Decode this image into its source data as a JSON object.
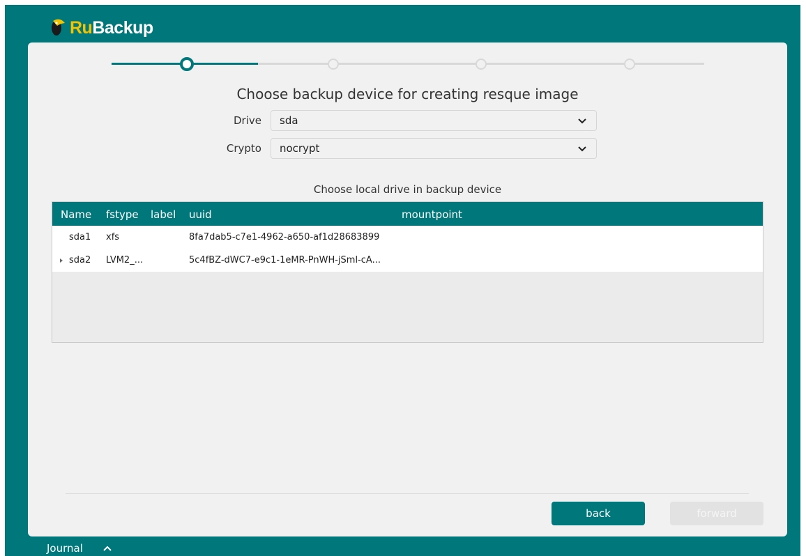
{
  "app": {
    "logo_prefix": "Ru",
    "logo_suffix": "Backup"
  },
  "wizard": {
    "title": "Choose backup device for creating resque image",
    "drive_label": "Drive",
    "drive_value": "sda",
    "crypto_label": "Crypto",
    "crypto_value": "nocrypt",
    "table_title": "Choose local drive in backup device"
  },
  "table": {
    "columns": [
      "Name",
      "fstype",
      "label",
      "uuid",
      "mountpoint"
    ],
    "rows": [
      {
        "name": "sda1",
        "fstype": "xfs",
        "label": "",
        "uuid": "8fa7dab5-c7e1-4962-a650-af1d28683899",
        "mountpoint": ""
      },
      {
        "name": "sda2",
        "fstype": "LVM2_...",
        "label": "",
        "uuid": "5c4fBZ-dWC7-e9c1-1eMR-PnWH-jSml-cA...",
        "mountpoint": ""
      }
    ]
  },
  "buttons": {
    "back": "back",
    "forward": "forward"
  },
  "footer": {
    "journal": "Journal"
  },
  "colors": {
    "accent": "#00777a",
    "logo_yellow": "#f2c300"
  },
  "stepper": {
    "steps": 5,
    "current": 2
  }
}
